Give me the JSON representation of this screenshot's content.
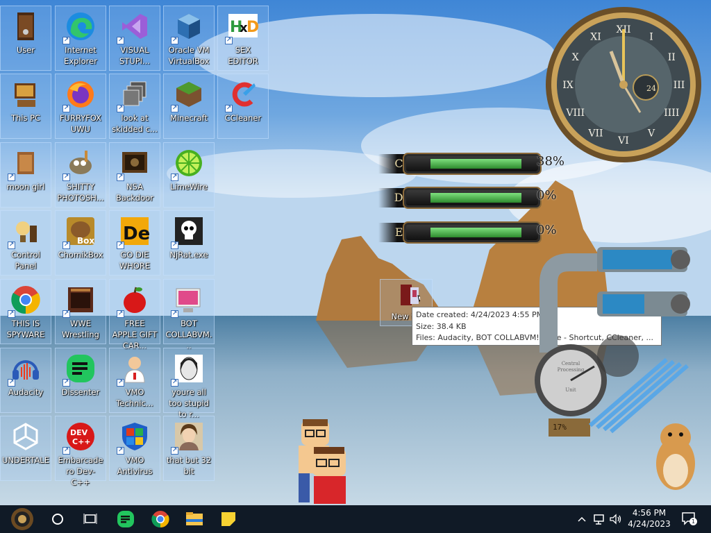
{
  "desktop": {
    "icons": [
      {
        "id": "user",
        "label": "User",
        "icon": "user-folder-icon"
      },
      {
        "id": "internet-explorer",
        "label": "Internet Explorer",
        "icon": "edge-browser-icon"
      },
      {
        "id": "visual-studio",
        "label": "VISUAL STUPI...",
        "icon": "visual-studio-icon"
      },
      {
        "id": "virtualbox",
        "label": "Oracle VM VirtualBox",
        "icon": "virtualbox-icon"
      },
      {
        "id": "sex-editor",
        "label": "SEX EDITOR",
        "icon": "hxd-editor-icon",
        "logo_text": "HxD"
      },
      {
        "id": "this-pc",
        "label": "This PC",
        "icon": "computer-icon"
      },
      {
        "id": "furryfox",
        "label": "FURRYFOX UWU",
        "icon": "firefox-icon"
      },
      {
        "id": "look-at-skidded",
        "label": "look at skidded c...",
        "icon": "stacked-windows-icon"
      },
      {
        "id": "minecraft",
        "label": "Minecraft",
        "icon": "minecraft-grass-block-icon"
      },
      {
        "id": "ccleaner",
        "label": "CCleaner",
        "icon": "ccleaner-icon"
      },
      {
        "id": "moon-girl",
        "label": "moon girl",
        "icon": "wooden-box-icon"
      },
      {
        "id": "shitty-photoshop",
        "label": "SHITTY PHOTOSH...",
        "icon": "gimp-icon"
      },
      {
        "id": "nsa-backdoor",
        "label": "NSA Backdoor",
        "icon": "steampunk-monitor-icon"
      },
      {
        "id": "limewire",
        "label": "LimeWire",
        "icon": "lime-icon"
      },
      {
        "id": "control-panel",
        "label": "Control Panel",
        "icon": "steampunk-lamp-icon"
      },
      {
        "id": "chomikbox",
        "label": "ChomikBox",
        "icon": "hamster-box-icon",
        "logo_text": "Box"
      },
      {
        "id": "go-die-whore",
        "label": "GO DIE WHORE",
        "icon": "dimension-de-icon",
        "logo_text": "De"
      },
      {
        "id": "njrat",
        "label": "NjRat.exe",
        "icon": "skull-icon"
      },
      {
        "id": "this-is-spyware",
        "label": "THIS IS SPYWARE",
        "icon": "chrome-icon"
      },
      {
        "id": "wwe-wrestling",
        "label": "WWE Wrestling",
        "icon": "steampunk-oven-icon"
      },
      {
        "id": "free-apple",
        "label": "FREE APPLE GIFT CAR...",
        "icon": "red-apple-icon"
      },
      {
        "id": "bot-collabvm",
        "label": "BOT COLLABVM...",
        "icon": "pink-monitor-icon"
      },
      {
        "id": "audacity",
        "label": "Audacity",
        "icon": "audacity-headphones-icon"
      },
      {
        "id": "dissenter",
        "label": "Dissenter",
        "icon": "dissenter-chat-icon"
      },
      {
        "id": "vmo-technic",
        "label": "VMO Technic...",
        "icon": "doctor-icon"
      },
      {
        "id": "youre-all-too-stupid",
        "label": "youre all too stupid to r...",
        "icon": "portrait-sketch-icon"
      },
      {
        "id": "undertale",
        "label": "UNDERTALE",
        "icon": "unity-icon"
      },
      {
        "id": "embarcadero",
        "label": "Embarcadero Dev-C++",
        "icon": "devcpp-icon",
        "logo_text": "DEV C++"
      },
      {
        "id": "vmo-antivirus",
        "label": "VMO Antivirus",
        "icon": "windows-shield-icon"
      },
      {
        "id": "that-but-32bit",
        "label": "that but 32 bit",
        "icon": "portrait-painting-icon"
      }
    ],
    "new_folder": {
      "label": "New f...",
      "icon": "folder-book-icon"
    }
  },
  "tooltip": {
    "date_created": "Date created: 4/24/2023 4:55 PM",
    "size": "Size: 38.4 KB",
    "files": "Files: Audacity, BOT COLLABVM!!!.exe - Shortcut, CCleaner, ..."
  },
  "gadgets": {
    "clock": {
      "numerals": [
        "XII",
        "I",
        "II",
        "III",
        "IIII",
        "V",
        "VI",
        "VII",
        "VIII",
        "IX",
        "X",
        "XI"
      ],
      "date_dial": "24"
    },
    "drives": [
      {
        "letter": "C:",
        "percent_text": "38%",
        "fill": 0.6
      },
      {
        "letter": "D:",
        "percent_text": "0%",
        "fill": 0.6
      },
      {
        "letter": "E:",
        "percent_text": "0%",
        "fill": 0.6
      }
    ],
    "gauge_readout": "17%",
    "gauge_dial_text": [
      "Central",
      "Processing",
      "Unit"
    ]
  },
  "taskbar": {
    "start": "start-button",
    "items": [
      "cortana-circle-icon",
      "task-view-icon",
      "dissenter-taskbar-icon",
      "chrome-taskbar-icon",
      "file-explorer-icon",
      "sticky-notes-icon"
    ],
    "time": "4:56 PM",
    "date": "4/24/2023",
    "notification_count": "1"
  },
  "colors": {
    "taskbar": "#101a26",
    "tooltip_bg": "#ffffff",
    "gauge_fill": "#3aa83a"
  }
}
